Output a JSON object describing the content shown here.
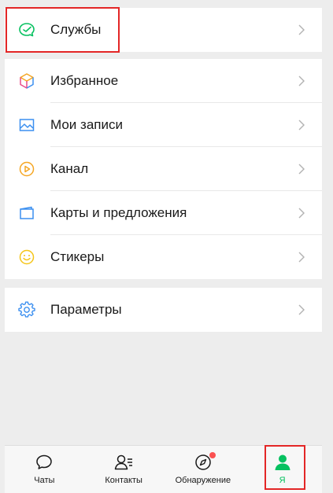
{
  "sections": {
    "services": {
      "label": "Службы"
    },
    "main": [
      {
        "label": "Избранное",
        "icon": "cube-icon"
      },
      {
        "label": "Мои записи",
        "icon": "image-icon"
      },
      {
        "label": "Канал",
        "icon": "play-circle-icon"
      },
      {
        "label": "Карты и предложения",
        "icon": "card-icon"
      },
      {
        "label": "Стикеры",
        "icon": "smile-icon"
      }
    ],
    "settings": {
      "label": "Параметры"
    }
  },
  "tabbar": [
    {
      "label": "Чаты",
      "icon": "chat-bubble-icon",
      "active": false
    },
    {
      "label": "Контакты",
      "icon": "contacts-icon",
      "active": false
    },
    {
      "label": "Обнаружение",
      "icon": "compass-icon",
      "active": false,
      "badge": true
    },
    {
      "label": "Я",
      "icon": "person-icon",
      "active": true
    }
  ],
  "colors": {
    "accent": "#07c160",
    "highlight": "#e32626",
    "badge": "#fa5151",
    "background": "#ededed"
  }
}
